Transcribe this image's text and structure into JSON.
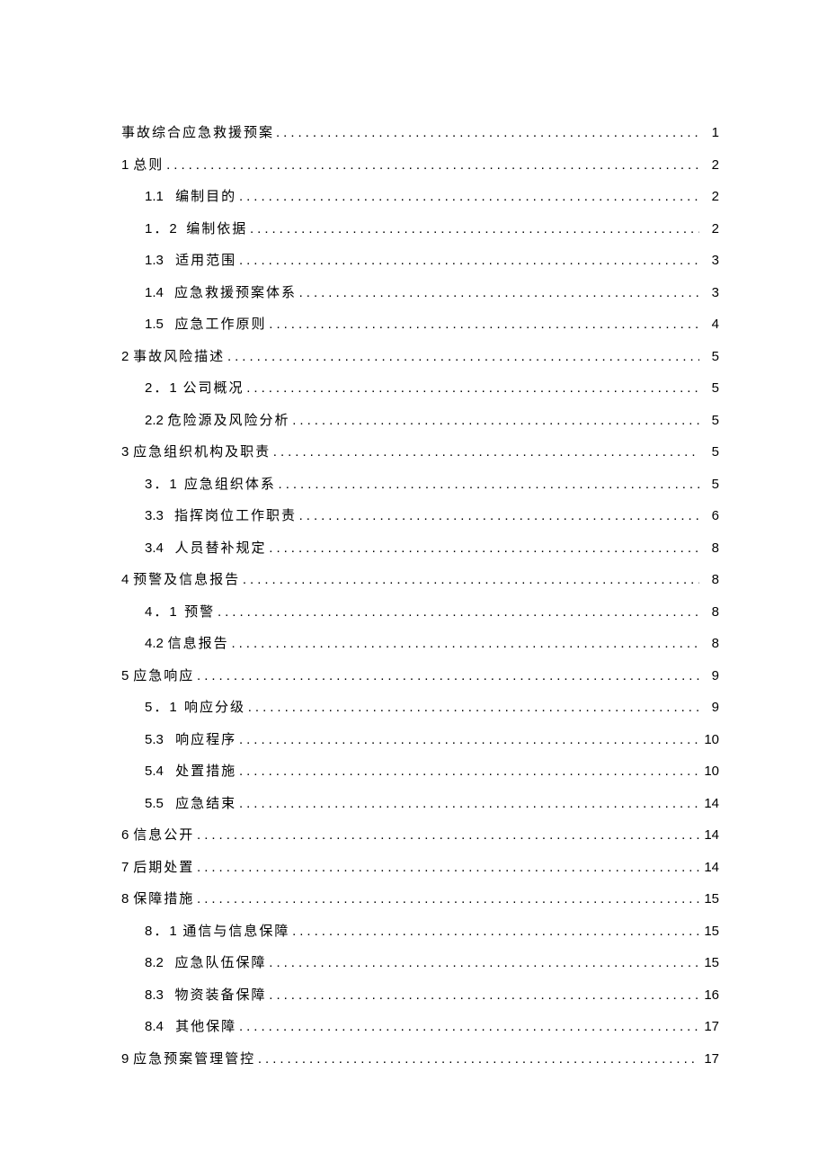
{
  "toc": [
    {
      "level": 0,
      "num": "",
      "numGap": 0,
      "title": "事故综合应急救援预案",
      "titleGap": 0,
      "page": "1"
    },
    {
      "level": 0,
      "num": "1",
      "numGap": 2,
      "title": "总则",
      "titleGap": 2,
      "page": "2"
    },
    {
      "level": 1,
      "num": "1.1",
      "numGap": 24,
      "title": "编制目的",
      "titleGap": 2,
      "page": "2"
    },
    {
      "level": 1,
      "num": "1．2",
      "numGap": 12,
      "title": "编制依据",
      "titleGap": 2,
      "page": "2"
    },
    {
      "level": 1,
      "num": "1.3",
      "numGap": 24,
      "title": "适用范围",
      "titleGap": 2,
      "page": "3"
    },
    {
      "level": 1,
      "num": "1.4",
      "numGap": 24,
      "title": "应急救援预案体系",
      "titleGap": 2,
      "page": "3"
    },
    {
      "level": 1,
      "num": "1.5",
      "numGap": 24,
      "title": "应急工作原则",
      "titleGap": 2,
      "page": "4"
    },
    {
      "level": 0,
      "num": "2",
      "numGap": 2,
      "title": "事故风险描述",
      "titleGap": 2,
      "page": "5"
    },
    {
      "level": 1,
      "num": "2．1",
      "numGap": 2,
      "title": "公司概况",
      "titleGap": 2,
      "page": "5"
    },
    {
      "level": 1,
      "num": "2.2",
      "numGap": 2,
      "title": "危险源及风险分析",
      "titleGap": 2,
      "page": "5"
    },
    {
      "level": 0,
      "num": "3",
      "numGap": 2,
      "title": "应急组织机构及职责",
      "titleGap": 2,
      "page": "5"
    },
    {
      "level": 1,
      "num": "3．1",
      "numGap": 6,
      "title": "应急组织体系",
      "titleGap": 2,
      "page": "5"
    },
    {
      "level": 1,
      "num": "3.3",
      "numGap": 24,
      "title": "指挥岗位工作职责",
      "titleGap": 2,
      "page": "6"
    },
    {
      "level": 1,
      "num": "3.4",
      "numGap": 24,
      "title": "人员替补规定",
      "titleGap": 2,
      "page": "8"
    },
    {
      "level": 0,
      "num": "4",
      "numGap": 2,
      "title": "预警及信息报告",
      "titleGap": 2,
      "page": "8"
    },
    {
      "level": 1,
      "num": "4．1",
      "numGap": 6,
      "title": "预警",
      "titleGap": 2,
      "page": "8"
    },
    {
      "level": 1,
      "num": "4.2",
      "numGap": 2,
      "title": "信息报告",
      "titleGap": 2,
      "page": "8"
    },
    {
      "level": 0,
      "num": "5",
      "numGap": 2,
      "title": "应急响应",
      "titleGap": 2,
      "page": "9"
    },
    {
      "level": 1,
      "num": "5．1",
      "numGap": 6,
      "title": "响应分级",
      "titleGap": 2,
      "page": "9"
    },
    {
      "level": 1,
      "num": "5.3",
      "numGap": 24,
      "title": "响应程序",
      "titleGap": 2,
      "page": "10"
    },
    {
      "level": 1,
      "num": "5.4",
      "numGap": 24,
      "title": "处置措施",
      "titleGap": 2,
      "page": "10"
    },
    {
      "level": 1,
      "num": "5.5",
      "numGap": 24,
      "title": "应急结束",
      "titleGap": 2,
      "page": "14"
    },
    {
      "level": 0,
      "num": "6",
      "numGap": 2,
      "title": "信息公开",
      "titleGap": 2,
      "page": "14"
    },
    {
      "level": 0,
      "num": "7",
      "numGap": 2,
      "title": "后期处置",
      "titleGap": 2,
      "page": "14"
    },
    {
      "level": 0,
      "num": "8",
      "numGap": 2,
      "title": "保障措施",
      "titleGap": 2,
      "page": "15"
    },
    {
      "level": 1,
      "num": "8．1",
      "numGap": 2,
      "title": "通信与信息保障",
      "titleGap": 2,
      "page": "15"
    },
    {
      "level": 1,
      "num": "8.2",
      "numGap": 24,
      "title": "应急队伍保障",
      "titleGap": 2,
      "page": "15"
    },
    {
      "level": 1,
      "num": "8.3",
      "numGap": 24,
      "title": "物资装备保障",
      "titleGap": 2,
      "page": "16"
    },
    {
      "level": 1,
      "num": "8.4",
      "numGap": 24,
      "title": "其他保障",
      "titleGap": 2,
      "page": "17"
    },
    {
      "level": 0,
      "num": "9",
      "numGap": 2,
      "title": "应急预案管理管控",
      "titleGap": 2,
      "page": "17"
    }
  ]
}
